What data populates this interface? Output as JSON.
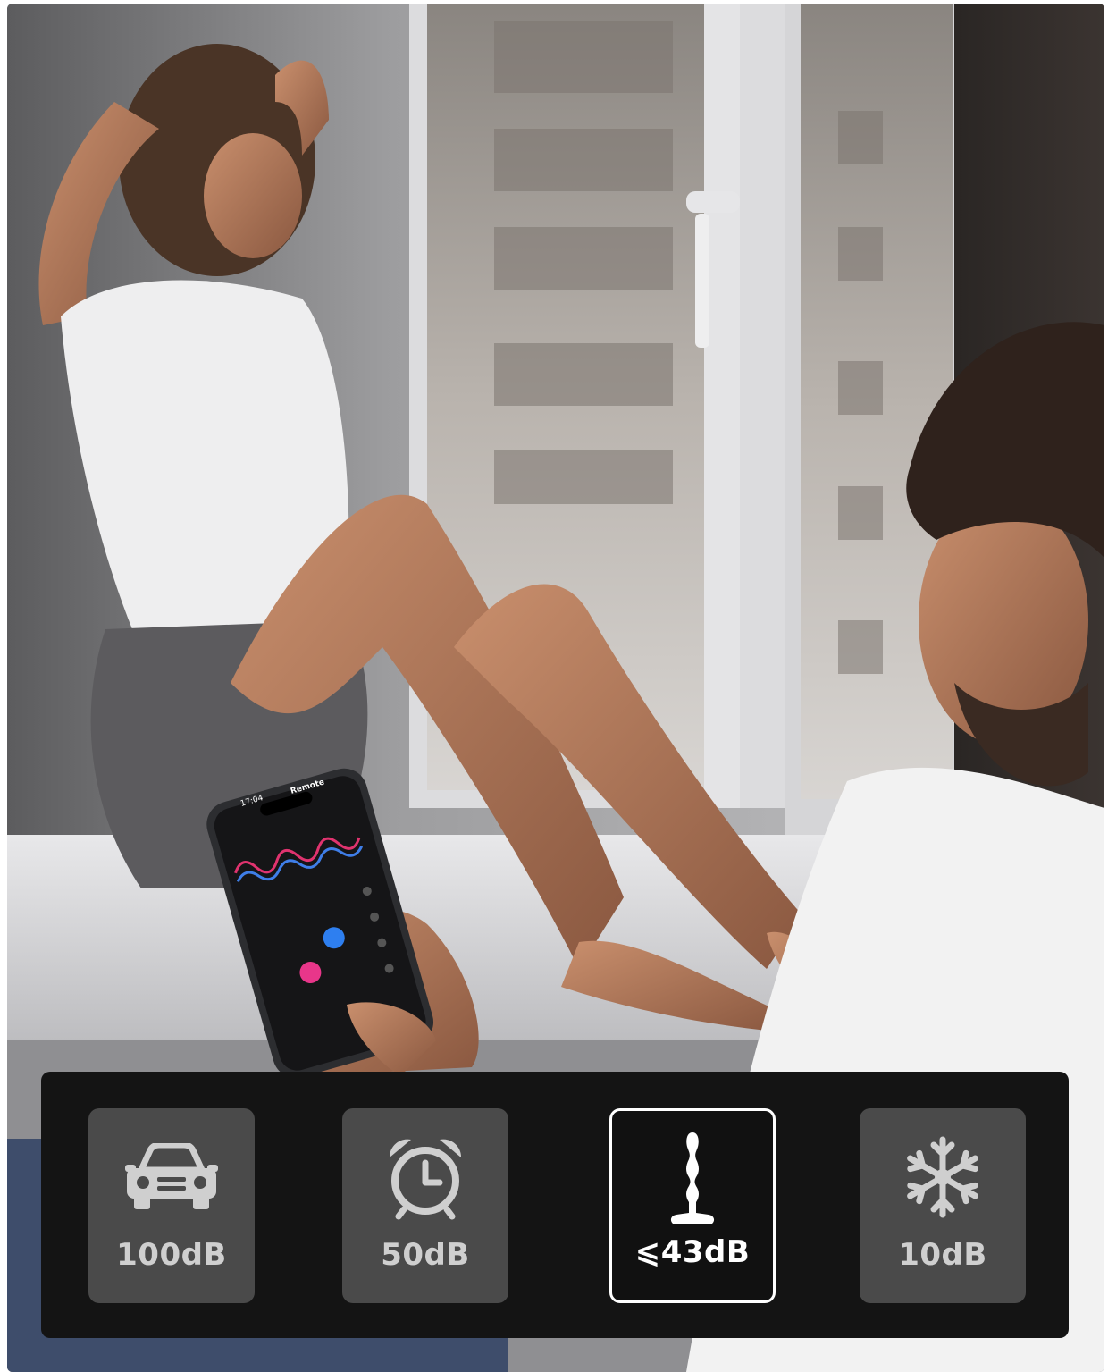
{
  "colors": {
    "panel_bg": "#141414",
    "tile_bg": "#4a4a4a",
    "tile_active_bg": "#111111",
    "icon_color": "#cfcfcf",
    "active_color": "#ffffff"
  },
  "phone": {
    "time": "17:04",
    "title": "Remote"
  },
  "comparison": {
    "items": [
      {
        "icon": "car-icon",
        "label": "100dB",
        "active": false
      },
      {
        "icon": "alarm-clock-icon",
        "label": "50dB",
        "active": false
      },
      {
        "icon": "product-icon",
        "label": "⩽43dB",
        "active": true
      },
      {
        "icon": "snowflake-icon",
        "label": "10dB",
        "active": false
      }
    ]
  }
}
